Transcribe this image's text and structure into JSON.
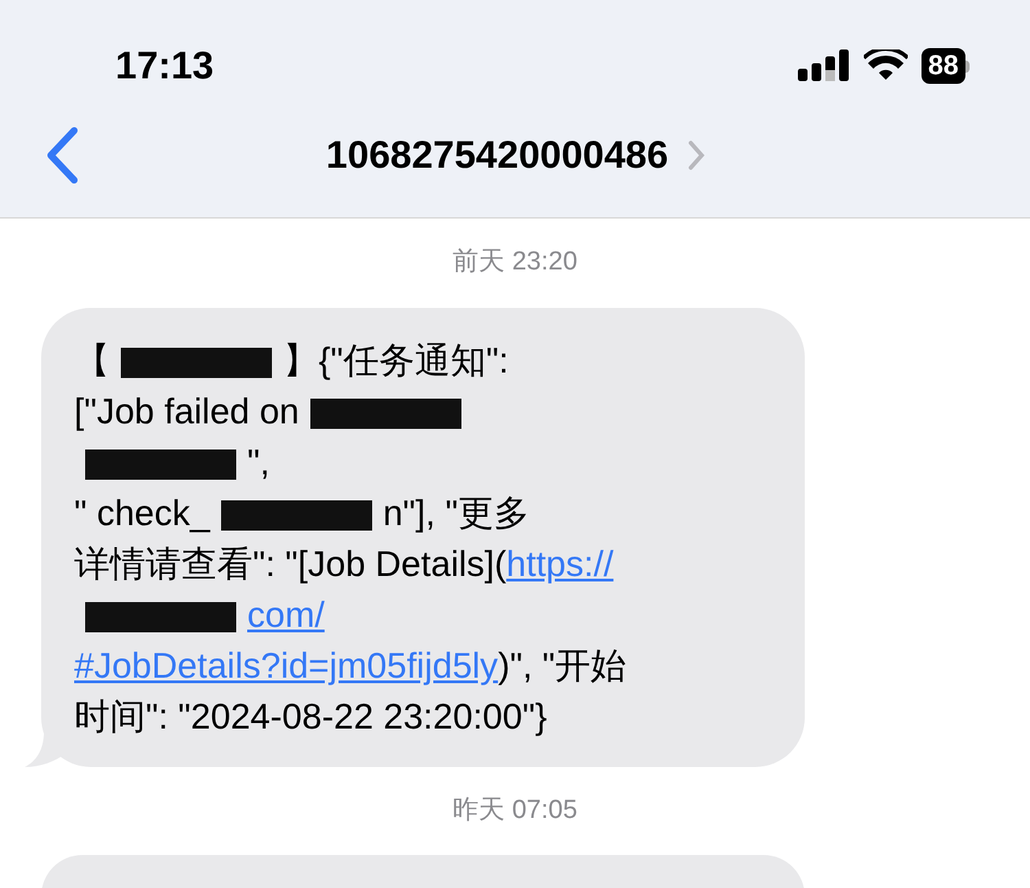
{
  "status_bar": {
    "time": "17:13",
    "battery": "88"
  },
  "nav": {
    "title": "1068275420000486"
  },
  "messages": [
    {
      "timestamp": "前天 23:20",
      "lines": [
        [
          {
            "kind": "text",
            "text": "【"
          },
          {
            "kind": "redacted"
          },
          {
            "kind": "text",
            "text": "】{\"任务通知\":"
          }
        ],
        [
          {
            "kind": "text",
            "text": "[\"Job failed on"
          },
          {
            "kind": "redacted"
          }
        ],
        [
          {
            "kind": "redacted"
          },
          {
            "kind": "text",
            "text": "\","
          }
        ],
        [
          {
            "kind": "text",
            "text": "\" check_"
          },
          {
            "kind": "redacted"
          },
          {
            "kind": "text",
            "text": "n\"], \"更多"
          }
        ],
        [
          {
            "kind": "text",
            "text": "详情请查看\": \"[Job Details]("
          },
          {
            "kind": "link",
            "text": "https://"
          }
        ],
        [
          {
            "kind": "redacted"
          },
          {
            "kind": "link",
            "text": "com/"
          }
        ],
        [
          {
            "kind": "link",
            "text": "#JobDetails?id=jm05fijd5ly"
          },
          {
            "kind": "text",
            "text": ")\", \"开始"
          }
        ],
        [
          {
            "kind": "text",
            "text": "时间\": \"2024-08-22 23:20:00\"}"
          }
        ]
      ]
    },
    {
      "timestamp": "昨天 07:05"
    }
  ]
}
